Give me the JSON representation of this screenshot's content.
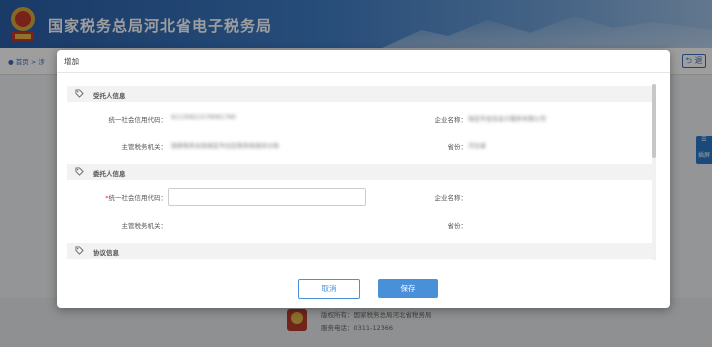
{
  "header": {
    "site_title": "国家税务总局河北省电子税务局"
  },
  "breadcrumb": {
    "home": "首页",
    "sep": ">",
    "current": "涉"
  },
  "back_button": {
    "label": "⮌ 退"
  },
  "float_tool": {
    "label": "插屏"
  },
  "footer": {
    "copyright": "版权所有：国家税务总局河北省税务局",
    "phone": "服务电话：0311-12366"
  },
  "modal": {
    "title": "增加",
    "sections": [
      {
        "label": "受托人信息"
      },
      {
        "label": "委托人信息"
      },
      {
        "label": "协议信息"
      }
    ],
    "trustee": {
      "credit_code_label": "统一社会信用代码：",
      "credit_code_value": "91130621579061790",
      "company_name_label": "企业名称：",
      "company_name_value": "保定市金信会计服务有限公司",
      "tax_office_label": "主管税务机关：",
      "tax_office_value": "国家税务总局保定市达区税务局城关分局",
      "province_label": "省份：",
      "province_value": "河北省"
    },
    "principal": {
      "required_mark": "*",
      "credit_code_label": "统一社会信用代码：",
      "credit_code_value": "",
      "company_name_label": "企业名称：",
      "tax_office_label": "主管税务机关：",
      "province_label": "省份："
    },
    "buttons": {
      "cancel": "取消",
      "save": "保存"
    }
  }
}
